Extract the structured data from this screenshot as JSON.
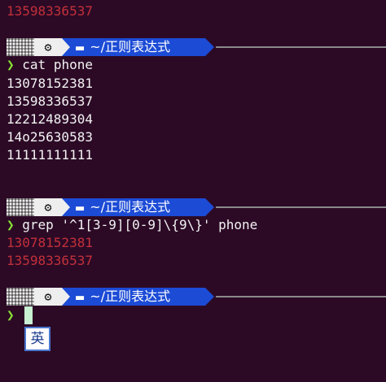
{
  "top_output": {
    "line": "13598336537"
  },
  "prompt": {
    "os_icon": "gear-icon",
    "folder_icon": "folder-icon",
    "path": "~/正则表达式"
  },
  "chevron": "❯",
  "cmd1": {
    "text": "cat phone",
    "output": [
      "13078152381",
      "13598336537",
      "12212489304",
      "14o25630583",
      "11111111111"
    ]
  },
  "cmd2": {
    "text": "grep '^1[3-9][0-9]\\{9\\}' phone",
    "output": [
      "13078152381",
      "13598336537"
    ]
  },
  "ime": {
    "label": "英"
  },
  "colors": {
    "background": "#2c0a26",
    "path_segment": "#1c4bd6",
    "match_output": "#c3303a",
    "chevron": "#8ae234"
  }
}
